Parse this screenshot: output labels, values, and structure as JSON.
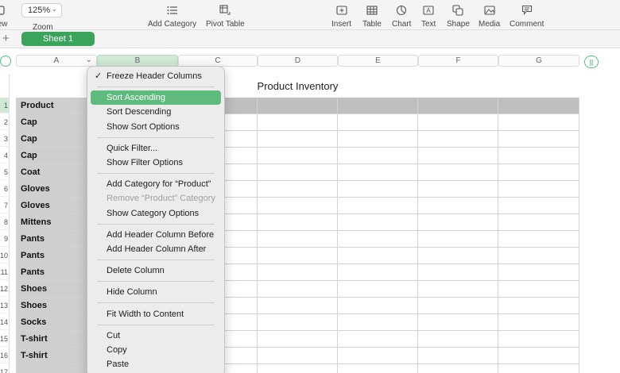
{
  "toolbar": {
    "view_label": "View",
    "zoom_value": "125%",
    "zoom_label": "Zoom",
    "add_category_label": "Add Category",
    "pivot_table_label": "Pivot Table",
    "insert_label": "Insert",
    "table_label": "Table",
    "chart_label": "Chart",
    "text_label": "Text",
    "shape_label": "Shape",
    "media_label": "Media",
    "comment_label": "Comment"
  },
  "sheets": [
    {
      "label": "Sheet 1",
      "active": true
    }
  ],
  "add_sheet_label": "+",
  "columns": [
    "A",
    "B",
    "C",
    "D",
    "E",
    "F",
    "G"
  ],
  "selected_column": "B",
  "table": {
    "title": "Product Inventory",
    "header": "Product",
    "rows": [
      "Cap",
      "Cap",
      "Cap",
      "Coat",
      "Gloves",
      "Gloves",
      "Mittens",
      "Pants",
      "Pants",
      "Pants",
      "Shoes",
      "Shoes",
      "Socks",
      "T-shirt",
      "T-shirt",
      ""
    ]
  },
  "row_numbers": [
    "1",
    "2",
    "3",
    "4",
    "5",
    "6",
    "7",
    "8",
    "9",
    "10",
    "11",
    "12",
    "13",
    "14",
    "15",
    "16",
    "17"
  ],
  "context_menu": {
    "groups": [
      [
        {
          "label": "Freeze Header Columns",
          "checked": true
        }
      ],
      [
        {
          "label": "Sort Ascending",
          "highlighted": true
        },
        {
          "label": "Sort Descending"
        },
        {
          "label": "Show Sort Options"
        }
      ],
      [
        {
          "label": "Quick Filter..."
        },
        {
          "label": "Show Filter Options"
        }
      ],
      [
        {
          "label": "Add Category for “Product”"
        },
        {
          "label": "Remove “Product” Category",
          "disabled": true
        },
        {
          "label": "Show Category Options"
        }
      ],
      [
        {
          "label": "Add Header Column Before"
        },
        {
          "label": "Add Header Column After"
        }
      ],
      [
        {
          "label": "Delete Column"
        }
      ],
      [
        {
          "label": "Hide Column"
        }
      ],
      [
        {
          "label": "Fit Width to Content"
        }
      ],
      [
        {
          "label": "Cut"
        },
        {
          "label": "Copy"
        },
        {
          "label": "Paste"
        }
      ]
    ]
  },
  "colors": {
    "accent": "#3aa35c",
    "highlight": "#5fba7d",
    "header_fill": "#bfbfbf",
    "first_col_fill": "#cfcfcf"
  }
}
